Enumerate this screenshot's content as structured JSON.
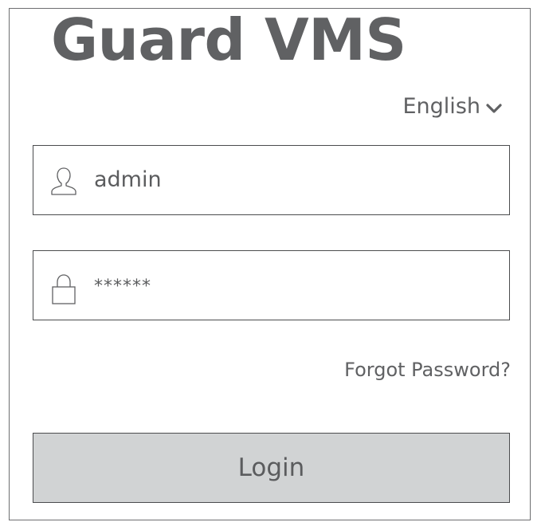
{
  "app": {
    "title": "Guard VMS"
  },
  "language": {
    "selected": "English",
    "icon": "chevron-down-icon"
  },
  "username": {
    "value": "admin",
    "icon": "user-icon"
  },
  "password": {
    "value": "******",
    "icon": "lock-icon"
  },
  "links": {
    "forgot_password": "Forgot Password?"
  },
  "actions": {
    "login_label": "Login"
  }
}
